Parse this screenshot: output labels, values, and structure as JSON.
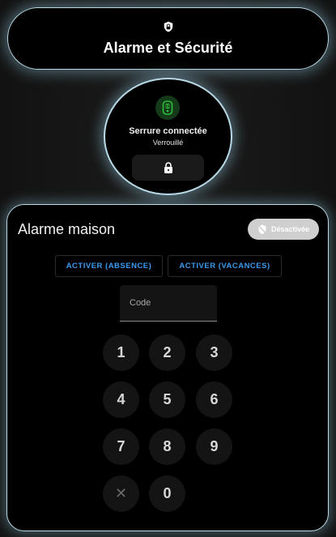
{
  "header": {
    "title": "Alarme et Sécurité",
    "icon": "shield-icon"
  },
  "lock": {
    "name": "Serrure connectée",
    "state": "Verrouillé",
    "status_icon": "smart-lock-icon",
    "action_icon": "padlock-icon",
    "status_color": "#2fbf3c"
  },
  "alarm": {
    "title": "Alarme maison",
    "state_label": "Désactivée",
    "state_icon": "shield-off-icon",
    "actions": [
      {
        "label": "ACTIVER (ABSENCE)"
      },
      {
        "label": "ACTIVER (VACANCES)"
      }
    ],
    "code_placeholder": "Code",
    "keypad": {
      "keys": [
        "1",
        "2",
        "3",
        "4",
        "5",
        "6",
        "7",
        "8",
        "9",
        "0"
      ],
      "clear_symbol": "✕"
    },
    "accent_color": "#3c9bf0"
  }
}
